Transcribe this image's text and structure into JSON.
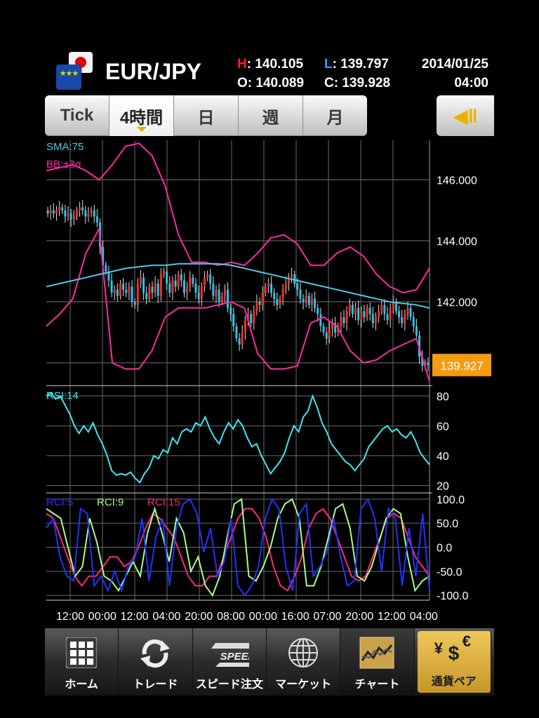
{
  "header": {
    "pair": "EUR/JPY",
    "flag_labels": [
      "EU",
      "JP"
    ],
    "h_label": "H",
    "h_value": ": 140.105",
    "l_label": "L",
    "l_value": ": 139.797",
    "o_label": "O",
    "o_value": ": 140.089",
    "c_label": "C",
    "c_value": ": 139.928",
    "date": "2014/01/25",
    "time": "04:00"
  },
  "period_tabs": [
    {
      "label": "Tick",
      "active": false
    },
    {
      "label": "4時間",
      "active": true
    },
    {
      "label": "日",
      "active": false
    },
    {
      "label": "週",
      "active": false
    },
    {
      "label": "月",
      "active": false
    }
  ],
  "side_button_icon": "collapse-left-icon",
  "chart_data": [
    {
      "type": "candlestick",
      "panel": "price",
      "indicators": [
        "SMA:75",
        "BB:±3σ"
      ],
      "yticks": [
        "146.000",
        "144.000",
        "142.000"
      ],
      "ylim": [
        139.3,
        147.3
      ],
      "current_price": "139.927",
      "colors": {
        "up": "#ff2a2a",
        "down": "#22c8f0",
        "sma": "#4fc8ec",
        "bb": "#ff2aa0",
        "price_tag": "#f39c12"
      },
      "close": [
        144.9,
        145.0,
        144.9,
        145.0,
        145.1,
        145.0,
        144.8,
        144.9,
        144.7,
        144.8,
        145.0,
        145.1,
        145.0,
        144.8,
        144.9,
        145.0,
        144.8,
        144.6,
        143.8,
        143.2,
        143.0,
        142.7,
        142.3,
        142.4,
        142.2,
        142.6,
        142.4,
        142.3,
        142.5,
        142.0,
        141.9,
        142.6,
        142.8,
        142.3,
        142.1,
        142.5,
        142.3,
        142.6,
        142.2,
        142.9,
        143.0,
        142.6,
        142.3,
        142.7,
        142.5,
        142.9,
        142.7,
        142.3,
        142.5,
        142.8,
        142.6,
        142.3,
        142.1,
        142.5,
        142.8,
        142.9,
        142.6,
        142.2,
        142.4,
        142.0,
        142.2,
        142.4,
        141.8,
        141.6,
        141.2,
        140.8,
        140.6,
        141.0,
        141.4,
        141.6,
        141.3,
        141.7,
        142.0,
        141.9,
        142.3,
        142.5,
        142.6,
        142.3,
        142.1,
        141.9,
        142.1,
        142.4,
        142.6,
        142.8,
        142.9,
        142.6,
        142.4,
        142.1,
        142.0,
        142.2,
        141.9,
        142.1,
        141.8,
        141.6,
        141.2,
        141.0,
        140.8,
        141.1,
        141.3,
        141.0,
        141.2,
        141.5,
        141.3,
        141.7,
        141.9,
        141.6,
        141.8,
        141.4,
        141.7,
        141.5,
        141.8,
        141.6,
        141.3,
        141.5,
        141.7,
        141.9,
        141.6,
        141.4,
        141.8,
        142.0,
        141.7,
        141.5,
        141.3,
        141.6,
        141.8,
        141.5,
        141.2,
        140.9,
        140.2,
        139.9,
        140.0,
        139.93
      ],
      "sma": [
        142.5,
        142.6,
        142.7,
        142.8,
        142.9,
        143.0,
        143.1,
        143.15,
        143.2,
        143.2,
        143.25,
        143.25,
        143.25,
        143.25,
        143.2,
        143.1,
        143.0,
        142.9,
        142.8,
        142.7,
        142.6,
        142.5,
        142.4,
        142.3,
        142.2,
        142.1,
        142.0,
        141.95,
        141.9,
        141.8
      ],
      "bb_upper": [
        146.3,
        146.4,
        146.5,
        146.3,
        146.0,
        146.5,
        147.1,
        147.2,
        146.8,
        145.8,
        144.2,
        143.3,
        143.3,
        143.2,
        143.3,
        143.2,
        143.6,
        144.1,
        144.2,
        143.9,
        143.2,
        143.2,
        143.6,
        143.8,
        143.5,
        142.9,
        142.5,
        142.3,
        142.4,
        143.1
      ],
      "bb_lower": [
        141.2,
        141.6,
        142.1,
        143.6,
        144.4,
        140.0,
        139.8,
        139.8,
        140.4,
        141.5,
        141.8,
        141.8,
        141.8,
        141.9,
        142.0,
        141.8,
        140.3,
        139.8,
        139.8,
        139.9,
        141.3,
        141.5,
        141.2,
        140.4,
        140.0,
        140.1,
        140.4,
        140.6,
        140.8,
        139.4
      ]
    },
    {
      "type": "line",
      "panel": "rsi",
      "series": [
        {
          "name": "RSI:14",
          "color": "#3fe6f2"
        }
      ],
      "yticks": [
        "80",
        "60",
        "40",
        "20"
      ],
      "ylim": [
        16,
        86
      ],
      "values": [
        80,
        82,
        78,
        80,
        74,
        68,
        60,
        55,
        60,
        56,
        62,
        54,
        48,
        40,
        30,
        27,
        28,
        27,
        29,
        25,
        22,
        28,
        32,
        40,
        38,
        44,
        42,
        52,
        48,
        56,
        58,
        56,
        62,
        60,
        66,
        58,
        52,
        48,
        56,
        62,
        58,
        64,
        60,
        52,
        46,
        48,
        40,
        34,
        28,
        32,
        36,
        42,
        52,
        60,
        56,
        66,
        70,
        80,
        72,
        62,
        56,
        48,
        44,
        40,
        36,
        34,
        30,
        34,
        38,
        46,
        50,
        54,
        58,
        60,
        56,
        58,
        54,
        52,
        56,
        50,
        42,
        38,
        34
      ],
      "xlabels": [
        "12:00",
        "00:00",
        "12:00",
        "04:00",
        "20:00",
        "08:00",
        "00:00",
        "16:00",
        "07:00",
        "20:00",
        "12:00",
        "04:00"
      ]
    },
    {
      "type": "line",
      "panel": "rci",
      "series": [
        {
          "name": "RCI:5",
          "color": "#2233ff"
        },
        {
          "name": "RCI:9",
          "color": "#aaff88"
        },
        {
          "name": "RCI:15",
          "color": "#ff2a7a"
        }
      ],
      "yticks": [
        "100.0",
        "50.0",
        "0.0",
        "-50.0",
        "-100.0"
      ],
      "ylim": [
        -110,
        110
      ],
      "rci5": [
        40,
        60,
        -20,
        -60,
        -70,
        80,
        70,
        -80,
        -60,
        -90,
        -50,
        -90,
        -40,
        -20,
        60,
        -70,
        20,
        60,
        -80,
        40,
        90,
        100,
        70,
        -10,
        40,
        -60,
        -30,
        60,
        -80,
        -100,
        -80,
        -40,
        60,
        100,
        80,
        -40,
        -90,
        70,
        90,
        -60,
        -40,
        -10,
        60,
        -20,
        -80,
        -70,
        80,
        100,
        60,
        -50,
        80,
        60,
        -80,
        40,
        -60,
        70,
        -90
      ],
      "rci9": [
        80,
        70,
        60,
        0,
        -60,
        -40,
        60,
        10,
        -60,
        -70,
        -90,
        -60,
        -30,
        -60,
        30,
        80,
        30,
        -30,
        60,
        30,
        -50,
        -20,
        -80,
        -100,
        -60,
        20,
        90,
        100,
        -60,
        -70,
        -40,
        0,
        60,
        90,
        100,
        60,
        -80,
        -80,
        -40,
        20,
        80,
        90,
        40,
        -60,
        -70,
        -40,
        10,
        60,
        80,
        70,
        -20,
        -90,
        -70,
        -60
      ],
      "rci15": [
        70,
        60,
        20,
        -20,
        -60,
        -80,
        -60,
        -60,
        -40,
        -20,
        -20,
        -40,
        -30,
        0,
        40,
        70,
        60,
        40,
        20,
        -20,
        -60,
        -80,
        -80,
        -60,
        -60,
        -20,
        20,
        60,
        80,
        80,
        60,
        20,
        -40,
        -80,
        -90,
        -60,
        -20,
        40,
        70,
        80,
        60,
        20,
        -20,
        -60,
        -70,
        -60,
        -20,
        20,
        60,
        70,
        60,
        20,
        -20,
        -40,
        -60
      ]
    }
  ],
  "bottom_tabs": [
    {
      "label": "ホーム",
      "icon": "grid-home-icon"
    },
    {
      "label": "トレード",
      "icon": "refresh-trade-icon"
    },
    {
      "label": "スピード注文",
      "icon": "speed-icon",
      "badge": "SPEED"
    },
    {
      "label": "マーケット",
      "icon": "globe-icon"
    },
    {
      "label": "チャート",
      "icon": "chart-icon",
      "active": true
    },
    {
      "label": "通貨ペア",
      "icon": "currency-pair-icon"
    }
  ],
  "currency_symbols": [
    "¥",
    "$",
    "€"
  ]
}
